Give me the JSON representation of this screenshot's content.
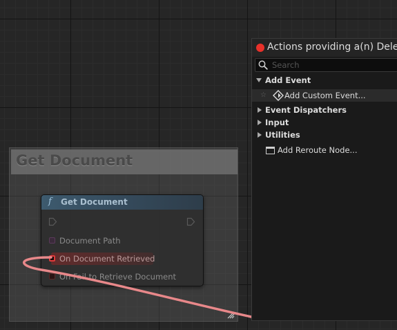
{
  "comment": {
    "title": "Get Document"
  },
  "node": {
    "title": "Get Document",
    "fn_icon": "f",
    "pins": [
      {
        "label": "Document Path",
        "color": "#8a3a8a"
      },
      {
        "label": "On Document Retrieved",
        "color": "#d42a2a"
      },
      {
        "label": "On Fail to Retrieve Document",
        "color": "#8a2020"
      }
    ]
  },
  "wire": {
    "color": "#e8888a"
  },
  "action_menu": {
    "title": "Actions providing a(n) Dele",
    "search_placeholder": "Search",
    "items": [
      {
        "label": "Add Event",
        "kind": "category-expanded"
      },
      {
        "label": "Add Custom Event...",
        "kind": "action",
        "icon": "event-diamond-icon"
      },
      {
        "label": "Event Dispatchers",
        "kind": "category-collapsed"
      },
      {
        "label": "Input",
        "kind": "category-collapsed"
      },
      {
        "label": "Utilities",
        "kind": "category-collapsed"
      },
      {
        "label": "Add Reroute Node...",
        "kind": "action",
        "icon": "reroute-node-icon"
      }
    ]
  },
  "colors": {
    "close_dot": "#e8312a",
    "node_header": "#3d5a6e"
  }
}
